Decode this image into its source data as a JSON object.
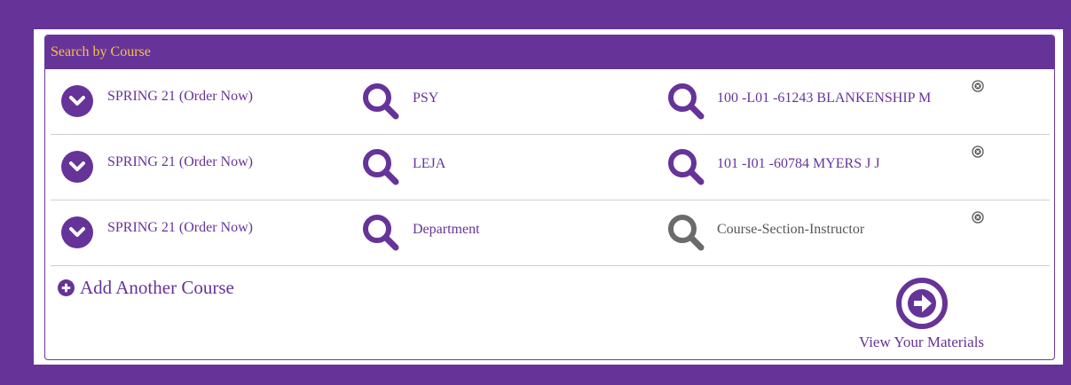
{
  "panel": {
    "title": "Search by Course"
  },
  "rows": [
    {
      "term": "SPRING 21 (Order Now)",
      "department": "PSY",
      "course": "100 -L01 -61243 BLANKENSHIP M",
      "course_is_placeholder": false
    },
    {
      "term": "SPRING 21 (Order Now)",
      "department": "LEJA",
      "course": "101 -I01 -60784 MYERS J J",
      "course_is_placeholder": false
    },
    {
      "term": "SPRING 21 (Order Now)",
      "department": "Department",
      "course": "Course-Section-Instructor",
      "course_is_placeholder": true
    }
  ],
  "actions": {
    "add_course": "Add Another Course",
    "view_materials": "View Your Materials"
  },
  "icons": {
    "term": "chevron-down-icon",
    "search": "search-icon",
    "remove": "close-icon",
    "add": "plus-circle-icon",
    "submit": "arrow-right-circle-icon"
  },
  "colors": {
    "accent": "#663399",
    "header_text": "#f5c242",
    "inactive_search": "#6b6b6b"
  }
}
